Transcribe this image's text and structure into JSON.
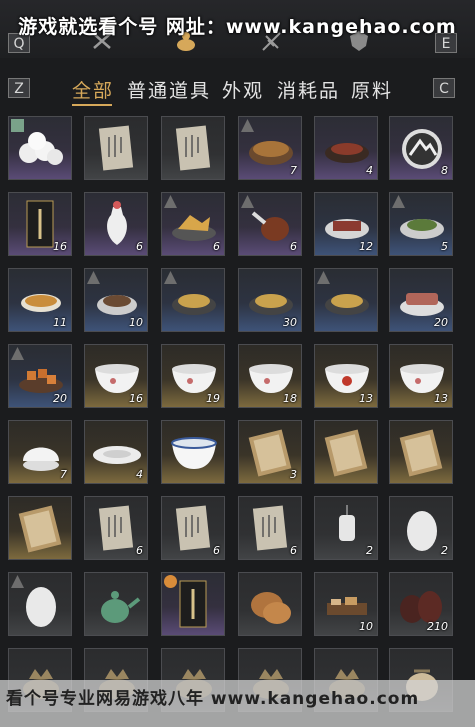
{
  "watermark": {
    "top": "游戏就选看个号  网址：www.kangehao.com",
    "bottom": "看个号专业网易游戏八年  www.kangehao.com"
  },
  "keys": {
    "q": "Q",
    "e": "E",
    "z": "Z",
    "c": "C"
  },
  "top_icons": [
    "close-icon",
    "gourd-icon",
    "feather-icon",
    "shield-icon"
  ],
  "tabs": [
    {
      "label": "全部",
      "active": true
    },
    {
      "label": "普通道具",
      "active": false
    },
    {
      "label": "外观",
      "active": false
    },
    {
      "label": "消耗品",
      "active": false
    },
    {
      "label": "原料",
      "active": false
    }
  ],
  "items": [
    {
      "icon": "steamed-buns-icon",
      "quality": "purple",
      "count": "",
      "badge": "green"
    },
    {
      "icon": "paper-note-icon",
      "quality": "grey",
      "count": "",
      "badge": ""
    },
    {
      "icon": "paper-note-icon",
      "quality": "grey",
      "count": "",
      "badge": ""
    },
    {
      "icon": "soup-pot-icon",
      "quality": "purple",
      "count": "7",
      "badge": "up"
    },
    {
      "icon": "meat-dish-icon",
      "quality": "purple",
      "count": "4",
      "badge": ""
    },
    {
      "icon": "mountain-emblem-icon",
      "quality": "purple",
      "count": "8",
      "badge": ""
    },
    {
      "icon": "token-card-icon",
      "quality": "purple",
      "count": "16",
      "badge": ""
    },
    {
      "icon": "white-vase-icon",
      "quality": "purple",
      "count": "6",
      "badge": ""
    },
    {
      "icon": "fried-dish-icon",
      "quality": "purple",
      "count": "6",
      "badge": "up"
    },
    {
      "icon": "roast-leg-icon",
      "quality": "purple",
      "count": "6",
      "badge": "up"
    },
    {
      "icon": "sliced-meat-icon",
      "quality": "blue",
      "count": "12",
      "badge": ""
    },
    {
      "icon": "greens-dish-icon",
      "quality": "blue",
      "count": "5",
      "badge": "up"
    },
    {
      "icon": "soup-bowl-icon",
      "quality": "blue",
      "count": "11",
      "badge": ""
    },
    {
      "icon": "stew-bowl-icon",
      "quality": "blue",
      "count": "10",
      "badge": "up"
    },
    {
      "icon": "noodle-plate-icon",
      "quality": "blue",
      "count": "",
      "badge": "up"
    },
    {
      "icon": "noodle-plate-icon",
      "quality": "blue",
      "count": "30",
      "badge": ""
    },
    {
      "icon": "noodle-plate-icon",
      "quality": "blue",
      "count": "",
      "badge": "up"
    },
    {
      "icon": "pork-plate-icon",
      "quality": "blue",
      "count": "20",
      "badge": ""
    },
    {
      "icon": "braised-cubes-icon",
      "quality": "blue",
      "count": "20",
      "badge": "up"
    },
    {
      "icon": "porcelain-bowl-icon",
      "quality": "gold",
      "count": "16",
      "badge": ""
    },
    {
      "icon": "porcelain-bowl-icon",
      "quality": "gold",
      "count": "19",
      "badge": ""
    },
    {
      "icon": "porcelain-bowl-icon",
      "quality": "gold",
      "count": "18",
      "badge": ""
    },
    {
      "icon": "rooster-bowl-icon",
      "quality": "gold",
      "count": "13",
      "badge": ""
    },
    {
      "icon": "porcelain-bowl-icon",
      "quality": "gold",
      "count": "13",
      "badge": ""
    },
    {
      "icon": "lidded-bowl-icon",
      "quality": "gold",
      "count": "7",
      "badge": ""
    },
    {
      "icon": "flat-dish-icon",
      "quality": "gold",
      "count": "4",
      "badge": ""
    },
    {
      "icon": "blue-rim-bowl-icon",
      "quality": "gold",
      "count": "",
      "badge": ""
    },
    {
      "icon": "book-icon",
      "quality": "gold",
      "count": "3",
      "badge": ""
    },
    {
      "icon": "book-icon",
      "quality": "gold",
      "count": "",
      "badge": ""
    },
    {
      "icon": "book-icon",
      "quality": "gold",
      "count": "",
      "badge": ""
    },
    {
      "icon": "book-icon",
      "quality": "gold",
      "count": "",
      "badge": ""
    },
    {
      "icon": "paper-note-icon",
      "quality": "grey",
      "count": "6",
      "badge": ""
    },
    {
      "icon": "paper-note-icon",
      "quality": "grey",
      "count": "6",
      "badge": ""
    },
    {
      "icon": "paper-note-icon",
      "quality": "grey",
      "count": "6",
      "badge": ""
    },
    {
      "icon": "lantern-icon",
      "quality": "grey",
      "count": "2",
      "badge": ""
    },
    {
      "icon": "egg-icon",
      "quality": "grey",
      "count": "2",
      "badge": ""
    },
    {
      "icon": "egg-icon",
      "quality": "grey",
      "count": "",
      "badge": "up"
    },
    {
      "icon": "teapot-icon",
      "quality": "grey",
      "count": "",
      "badge": ""
    },
    {
      "icon": "token-card-icon",
      "quality": "purple",
      "count": "",
      "badge": "clock"
    },
    {
      "icon": "flatbread-icon",
      "quality": "grey",
      "count": "",
      "badge": ""
    },
    {
      "icon": "tray-icon",
      "quality": "grey",
      "count": "10",
      "badge": ""
    },
    {
      "icon": "wine-jars-icon",
      "quality": "grey",
      "count": "210",
      "badge": ""
    },
    {
      "icon": "censer-icon",
      "quality": "grey",
      "count": "",
      "badge": ""
    },
    {
      "icon": "censer-icon",
      "quality": "grey",
      "count": "",
      "badge": ""
    },
    {
      "icon": "censer-icon",
      "quality": "grey",
      "count": "",
      "badge": ""
    },
    {
      "icon": "censer-icon",
      "quality": "grey",
      "count": "",
      "badge": ""
    },
    {
      "icon": "censer-icon",
      "quality": "grey",
      "count": "",
      "badge": ""
    },
    {
      "icon": "pouch-icon",
      "quality": "grey",
      "count": "",
      "badge": ""
    }
  ]
}
